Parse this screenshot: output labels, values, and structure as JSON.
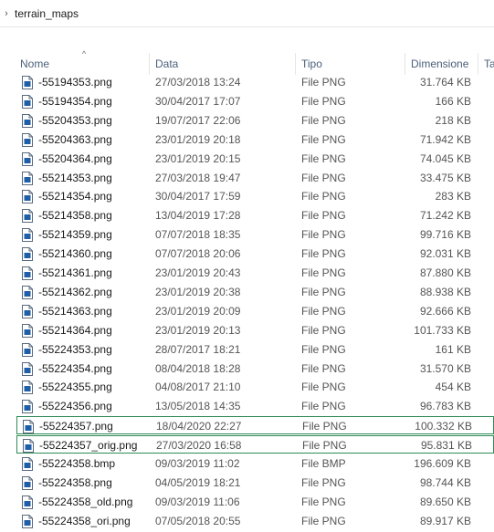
{
  "breadcrumb": {
    "label": "terrain_maps"
  },
  "columns": {
    "name": "Nome",
    "date": "Data",
    "type": "Tipo",
    "size": "Dimensione",
    "extra": "Ta"
  },
  "files": [
    {
      "name": "-55194353.png",
      "date": "27/03/2018 13:24",
      "type": "File PNG",
      "size": "31.764 KB",
      "selected": false
    },
    {
      "name": "-55194354.png",
      "date": "30/04/2017 17:07",
      "type": "File PNG",
      "size": "166 KB",
      "selected": false
    },
    {
      "name": "-55204353.png",
      "date": "19/07/2017 22:06",
      "type": "File PNG",
      "size": "218 KB",
      "selected": false
    },
    {
      "name": "-55204363.png",
      "date": "23/01/2019 20:18",
      "type": "File PNG",
      "size": "71.942 KB",
      "selected": false
    },
    {
      "name": "-55204364.png",
      "date": "23/01/2019 20:15",
      "type": "File PNG",
      "size": "74.045 KB",
      "selected": false
    },
    {
      "name": "-55214353.png",
      "date": "27/03/2018 19:47",
      "type": "File PNG",
      "size": "33.475 KB",
      "selected": false
    },
    {
      "name": "-55214354.png",
      "date": "30/04/2017 17:59",
      "type": "File PNG",
      "size": "283 KB",
      "selected": false
    },
    {
      "name": "-55214358.png",
      "date": "13/04/2019 17:28",
      "type": "File PNG",
      "size": "71.242 KB",
      "selected": false
    },
    {
      "name": "-55214359.png",
      "date": "07/07/2018 18:35",
      "type": "File PNG",
      "size": "99.716 KB",
      "selected": false
    },
    {
      "name": "-55214360.png",
      "date": "07/07/2018 20:06",
      "type": "File PNG",
      "size": "92.031 KB",
      "selected": false
    },
    {
      "name": "-55214361.png",
      "date": "23/01/2019 20:43",
      "type": "File PNG",
      "size": "87.880 KB",
      "selected": false
    },
    {
      "name": "-55214362.png",
      "date": "23/01/2019 20:38",
      "type": "File PNG",
      "size": "88.938 KB",
      "selected": false
    },
    {
      "name": "-55214363.png",
      "date": "23/01/2019 20:09",
      "type": "File PNG",
      "size": "92.666 KB",
      "selected": false
    },
    {
      "name": "-55214364.png",
      "date": "23/01/2019 20:13",
      "type": "File PNG",
      "size": "101.733 KB",
      "selected": false
    },
    {
      "name": "-55224353.png",
      "date": "28/07/2017 18:21",
      "type": "File PNG",
      "size": "161 KB",
      "selected": false
    },
    {
      "name": "-55224354.png",
      "date": "08/04/2018 18:28",
      "type": "File PNG",
      "size": "31.570 KB",
      "selected": false
    },
    {
      "name": "-55224355.png",
      "date": "04/08/2017 21:10",
      "type": "File PNG",
      "size": "454 KB",
      "selected": false
    },
    {
      "name": "-55224356.png",
      "date": "13/05/2018 14:35",
      "type": "File PNG",
      "size": "96.783 KB",
      "selected": false
    },
    {
      "name": "-55224357.png",
      "date": "18/04/2020 22:27",
      "type": "File PNG",
      "size": "100.332 KB",
      "selected": true
    },
    {
      "name": "-55224357_orig.png",
      "date": "27/03/2020 16:58",
      "type": "File PNG",
      "size": "95.831 KB",
      "selected": true
    },
    {
      "name": "-55224358.bmp",
      "date": "09/03/2019 11:02",
      "type": "File BMP",
      "size": "196.609 KB",
      "selected": false
    },
    {
      "name": "-55224358.png",
      "date": "04/05/2019 18:21",
      "type": "File PNG",
      "size": "98.744 KB",
      "selected": false
    },
    {
      "name": "-55224358_old.png",
      "date": "09/03/2019 11:06",
      "type": "File PNG",
      "size": "89.650 KB",
      "selected": false
    },
    {
      "name": "-55224358_ori.png",
      "date": "07/05/2018 20:55",
      "type": "File PNG",
      "size": "89.917 KB",
      "selected": false
    }
  ],
  "colors": {
    "selection_border": "#2e8b57",
    "header_text": "#4c607a"
  },
  "icons": {
    "breadcrumb": "chevron-right-icon",
    "file": "file-icon",
    "sort": "sort-ascending-icon"
  }
}
